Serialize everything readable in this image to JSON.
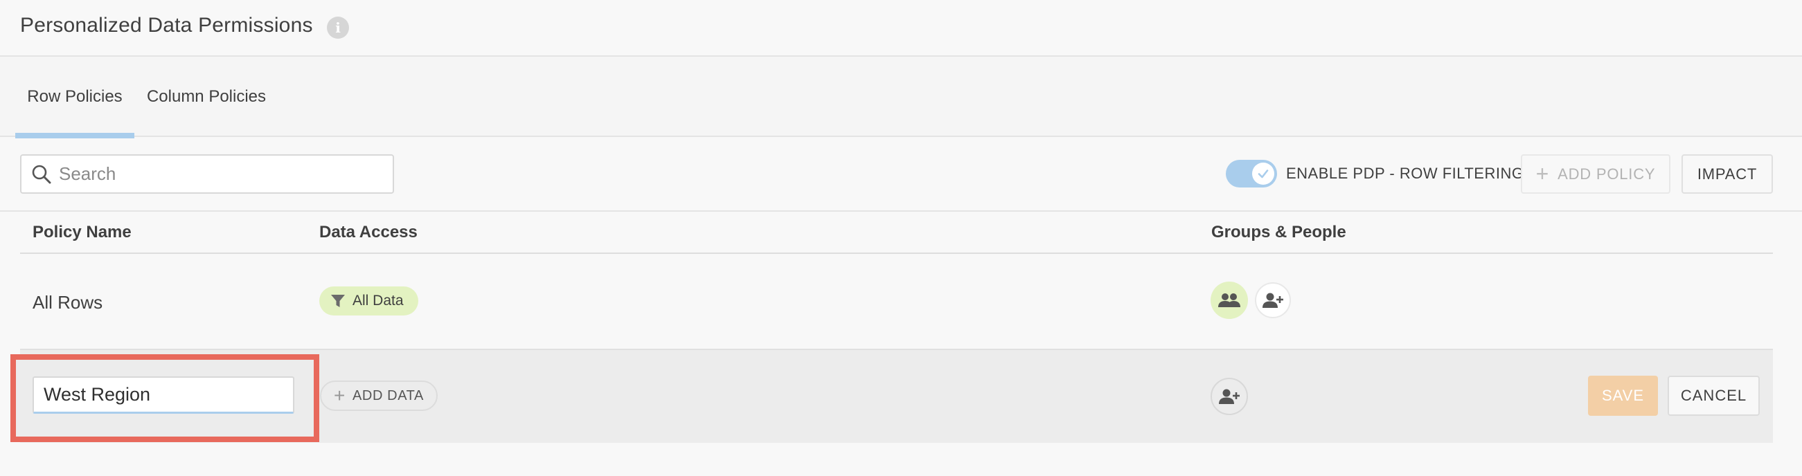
{
  "header": {
    "title": "Personalized Data Permissions",
    "info_icon": "info-icon"
  },
  "tabs": [
    {
      "label": "Row Policies",
      "active": true
    },
    {
      "label": "Column Policies",
      "active": false
    }
  ],
  "toolbar": {
    "search_placeholder": "Search",
    "search_value": "",
    "toggle_label": "ENABLE PDP - ROW FILTERING",
    "toggle_on": true,
    "add_policy_label": "ADD POLICY",
    "impact_label": "IMPACT"
  },
  "table": {
    "columns": [
      "Policy Name",
      "Data Access",
      "Groups & People"
    ],
    "rows": [
      {
        "name": "All Rows",
        "data_access": "All Data",
        "groups_icon": "people-group-icon",
        "add_person_icon": "person-add-icon"
      }
    ],
    "edit_row": {
      "name_value": "West Region",
      "add_data_label": "ADD DATA",
      "add_person_icon": "person-add-icon",
      "save_label": "SAVE",
      "cancel_label": "CANCEL"
    }
  },
  "colors": {
    "accent_blue": "#a9cdec",
    "chip_green": "#e3f2c1",
    "save_disabled": "#f3cfa6",
    "highlight_red": "#e8695c"
  }
}
